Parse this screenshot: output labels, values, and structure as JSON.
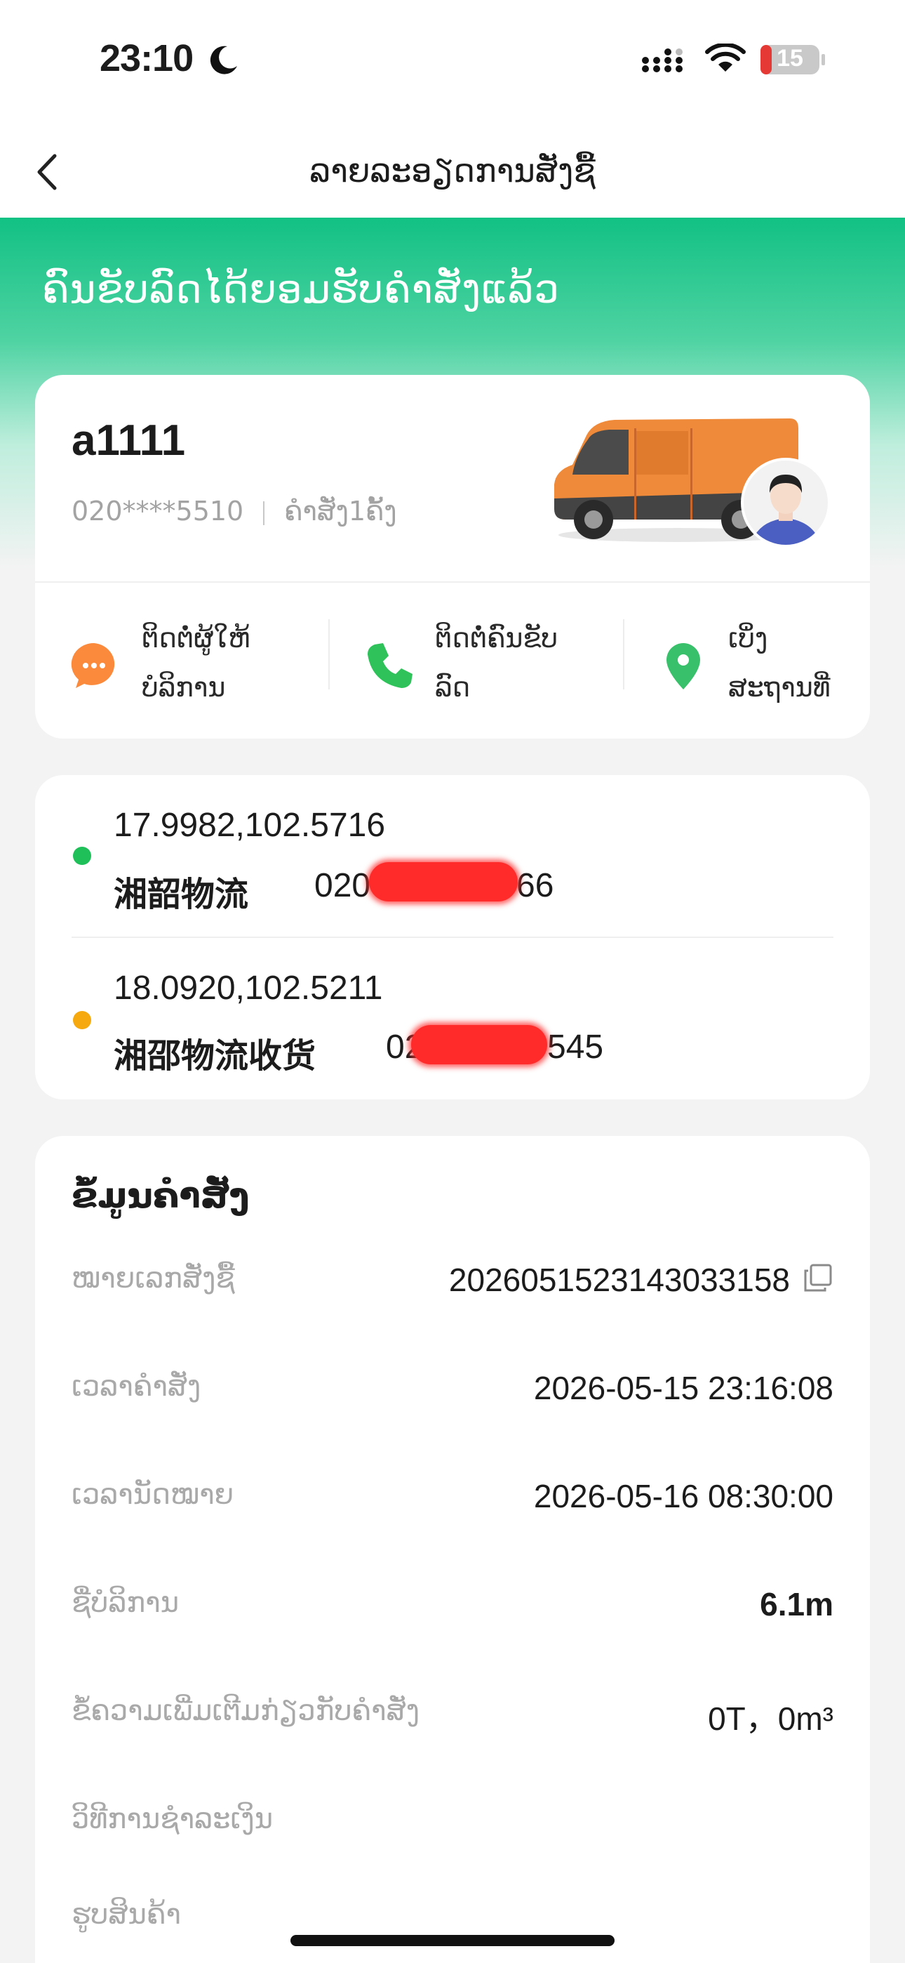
{
  "status_bar": {
    "time": "23:10",
    "battery": "15"
  },
  "nav": {
    "title": "ລາຍລະອຽດການສັ່ງຊື້"
  },
  "order_status": {
    "headline": "ຄົນຂັບລົດໄດ້ຍອມຮັບຄໍາສັ່ງແລ້ວ"
  },
  "driver": {
    "name": "a1111",
    "phone": "020****5510",
    "orders": "ຄໍາສັ່ງ1ຄັ້ງ"
  },
  "actions": [
    {
      "label_line1": "ຕິດຕໍ່ຜູ້ໃຫ້",
      "label_line2": "ບໍລິການ",
      "icon": "chat-icon"
    },
    {
      "label_line1": "ຕິດຕໍ່ຄົນຂັບ",
      "label_line2": "ລົດ",
      "icon": "phone-icon"
    },
    {
      "label_line1": "ເບິ່ງ",
      "label_line2": "ສະຖານທີ່",
      "icon": "location-pin-icon"
    }
  ],
  "route": {
    "pickup": {
      "coords": "17.9982,102.5716",
      "contact": "湘韶物流",
      "phone_prefix": "020",
      "phone_suffix": "66",
      "dot_color": "#1fbf5a"
    },
    "dropoff": {
      "coords": "18.0920,102.5211",
      "contact": "湘邵物流收货",
      "phone_prefix": "02",
      "phone_suffix": "545",
      "dot_color": "#f6a90f"
    }
  },
  "order_info": {
    "title": "ຂໍ້ມູນຄໍາສັ່ງ",
    "rows": [
      {
        "label": "ໝາຍເລກສັ່ງຊື້",
        "value": "2026051523143033158"
      },
      {
        "label": "ເວລາຄໍາສັ່ງ",
        "value": "2026-05-15 23:16:08"
      },
      {
        "label": "ເວລານັດໝາຍ",
        "value": "2026-05-16 08:30:00"
      },
      {
        "label": "ຊື່ບໍລິການ",
        "value": "6.1m"
      },
      {
        "label": "ຂໍ້ຄວາມເພີ່ມເຕີມກ່ຽວກັບຄໍາສັ່ງ",
        "value": "0T，0m³"
      },
      {
        "label": "ວິທີການຊໍາລະເງິນ",
        "value": ""
      },
      {
        "label": "ຮູບສິນຄ້າ",
        "value": ""
      }
    ]
  },
  "colors": {
    "brand_green": "#12c184",
    "chat_orange": "#fb8a3c",
    "phone_green": "#2fc25b",
    "pin_green": "#38c06a"
  }
}
